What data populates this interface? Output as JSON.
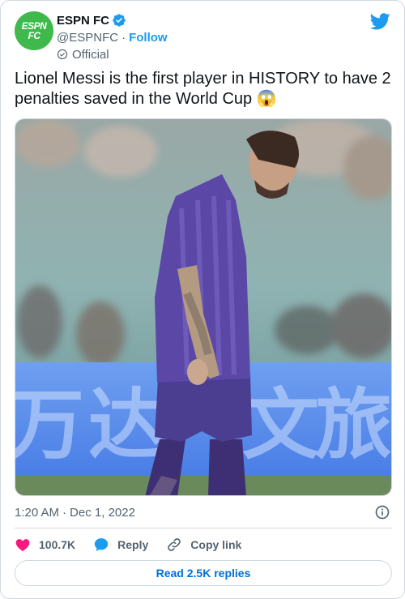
{
  "author": {
    "name": "ESPN FC",
    "handle": "@ESPNFC",
    "separator": "·",
    "follow_label": "Follow",
    "label": "Official",
    "avatar_line1": "ESPN",
    "avatar_line2": "FC",
    "avatar_color": "#3fb94b"
  },
  "tweet": {
    "text": "Lionel Messi is the first player in HISTORY to have 2 penalties saved in the World Cup 😱",
    "time": "1:20 AM",
    "separator": "·",
    "date": "Dec 1, 2022"
  },
  "actions": {
    "likes": "100.7K",
    "reply_label": "Reply",
    "copy_label": "Copy link",
    "read_replies_label": "Read 2.5K replies"
  },
  "colors": {
    "accent": "#1d9bf0",
    "like": "#f91880",
    "link": "#006fd6"
  },
  "icons": [
    "verified-badge-icon",
    "twitter-bird-icon",
    "official-check-icon",
    "info-icon",
    "heart-icon",
    "reply-bubble-icon",
    "link-icon"
  ]
}
